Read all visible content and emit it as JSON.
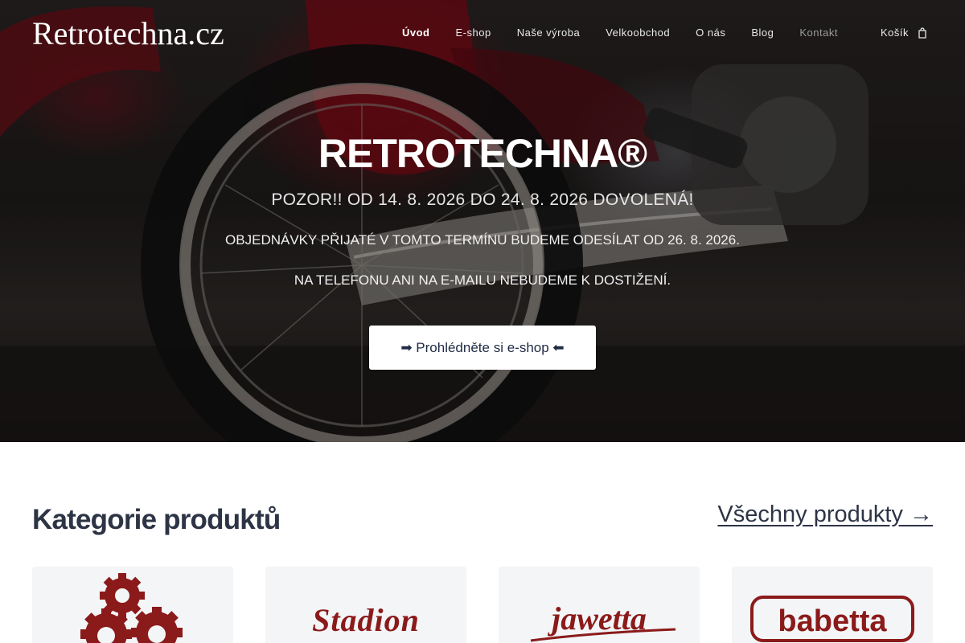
{
  "header": {
    "brand": "Retrotechna.cz",
    "nav": [
      {
        "label": "Úvod",
        "active": true
      },
      {
        "label": "E-shop",
        "active": false
      },
      {
        "label": "Naše výroba",
        "active": false
      },
      {
        "label": "Velkoobchod",
        "active": false
      },
      {
        "label": "O nás",
        "active": false
      },
      {
        "label": "Blog",
        "active": false
      },
      {
        "label": "Kontakt",
        "active": false
      }
    ],
    "cart_label": "Košík",
    "cart_icon": "shopping-bag-icon"
  },
  "hero": {
    "title": "RETROTECHNA®",
    "subtitle": "POZOR!! OD 14. 8. 2026 DO 24. 8. 2026 DOVOLENÁ!",
    "line1": "OBJEDNÁVKY PŘIJATÉ V TOMTO TERMÍNU BUDEME ODESÍLAT OD 26. 8. 2026.",
    "line2": "NA TELEFONU ANI NA E-MAILU NEBUDEME K DOSTIŽENÍ.",
    "cta_label": "➡ Prohlédněte si e-shop ⬅"
  },
  "categories": {
    "title": "Kategorie produktů",
    "all_link": "Všechny produkty →",
    "items": [
      {
        "name": "gears-logo"
      },
      {
        "name": "Stadion"
      },
      {
        "name": "jawetta"
      },
      {
        "name": "babetta"
      }
    ]
  },
  "colors": {
    "logo_red": "#8b1a1a",
    "heading": "#2d3445",
    "card_bg": "#f3f5f7"
  }
}
